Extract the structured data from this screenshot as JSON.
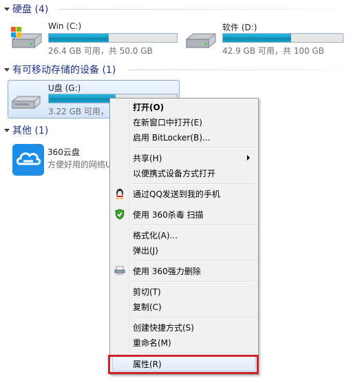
{
  "sections": {
    "hard_disks": {
      "title": "硬盘 (4)"
    },
    "removable": {
      "title": "有可移动存储的设备 (1)"
    },
    "other": {
      "title": "其他 (1)"
    }
  },
  "drives": [
    {
      "name": "Win (C:)",
      "space": "26.4 GB 可用，共 50.0 GB",
      "used_fraction": 0.47,
      "icon": "windows-drive-icon"
    },
    {
      "name": "软件 (D:)",
      "space": "42.9 GB 可用，共 100 GB",
      "used_fraction": 0.57,
      "icon": "hard-drive-icon"
    },
    {
      "name": "U盘 (G:)",
      "space": "3.22 GB 可用，共",
      "used_fraction": 0.52,
      "icon": "usb-drive-icon"
    }
  ],
  "other_items": [
    {
      "name": "360云盘",
      "description": "方便好用的网络U",
      "icon": "360-cloud-icon"
    }
  ],
  "context_menu": {
    "items": [
      {
        "label": "打开(O)",
        "bold": true
      },
      {
        "label": "在新窗口中打开(E)"
      },
      {
        "label": "启用 BitLocker(B)..."
      },
      {
        "label": "共享(H)",
        "submenu": true
      },
      {
        "label": "以便携式设备方式打开"
      },
      {
        "label": "通过QQ发送到我的手机",
        "icon": "qq-penguin-icon"
      },
      {
        "label": "使用 360杀毒 扫描",
        "icon": "360-antivirus-shield-icon"
      },
      {
        "label": "格式化(A)..."
      },
      {
        "label": "弹出(J)"
      },
      {
        "label": "使用 360强力删除",
        "icon": "shredder-icon"
      },
      {
        "label": "剪切(T)"
      },
      {
        "label": "复制(C)"
      },
      {
        "label": "创建快捷方式(S)"
      },
      {
        "label": "重命名(M)"
      },
      {
        "label": "属性(R)",
        "highlighted": true
      }
    ]
  },
  "colors": {
    "section_title": "#1e3287",
    "menu_highlight_border": "#d2232a",
    "progress_fill": "#1a9ec6"
  }
}
